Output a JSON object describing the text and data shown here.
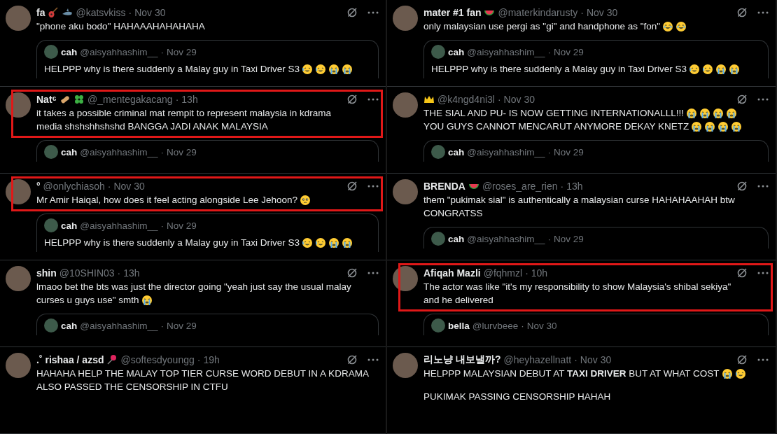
{
  "columns": [
    {
      "tweets": [
        {
          "name": "fa",
          "name_emojis": [
            {
              "kind": "guitar"
            },
            {
              "kind": "shark"
            }
          ],
          "handle": "@katsvkiss",
          "dot": "·",
          "time": "Nov 30",
          "highlighted": false,
          "lines": [
            {
              "text": "\"phone aku bodo\" HAHAAAHAHAHAHA"
            }
          ],
          "quote": {
            "name": "cah",
            "handle": "@aisyahhashim__",
            "dot": "·",
            "time": "Nov 29",
            "text": "HELPPP why is there suddenly a Malay guy in Taxi Driver S3",
            "emojis": [
              {
                "kind": "rofl"
              },
              {
                "kind": "rofl"
              },
              {
                "kind": "sob"
              },
              {
                "kind": "sob"
              }
            ]
          }
        },
        {
          "name": "Nat⁶",
          "name_emojis": [
            {
              "kind": "peanut"
            },
            {
              "kind": "clover"
            }
          ],
          "handle": "@_mentegakacang",
          "dot": "·",
          "time": "13h",
          "highlighted": true,
          "lines": [
            {
              "text": "it takes a possible criminal mat rempit to represent malaysia in kdrama"
            },
            {
              "text": "media shshshhshshd BANGGA JADI ANAK MALAYSIA"
            }
          ],
          "quote": {
            "name": "cah",
            "handle": "@aisyahhashim__",
            "dot": "·",
            "time": "Nov 29"
          }
        },
        {
          "name": "°",
          "handle": "@onlychiasoh",
          "dot": "·",
          "time": "Nov 30",
          "highlighted": true,
          "lines": [
            {
              "text": "Mr Amir Haiqal, how does it feel acting alongside Lee Jehoon?",
              "emojis": [
                {
                  "kind": "pleading"
                }
              ]
            }
          ],
          "quote": {
            "name": "cah",
            "handle": "@aisyahhashim__",
            "dot": "·",
            "time": "Nov 29",
            "text": "HELPPP why is there suddenly a Malay guy in Taxi Driver S3",
            "emojis": [
              {
                "kind": "rofl"
              },
              {
                "kind": "rofl"
              },
              {
                "kind": "sob"
              },
              {
                "kind": "sob"
              }
            ]
          }
        },
        {
          "name": "shin",
          "handle": "@10SHIN03",
          "dot": "·",
          "time": "13h",
          "highlighted": false,
          "lines": [
            {
              "text": "lmaoo bet the bts was just the director going \"yeah just say the usual malay"
            },
            {
              "text": "curses u guys use\" smth",
              "emojis": [
                {
                  "kind": "sob"
                }
              ]
            }
          ],
          "quote": {
            "name": "cah",
            "handle": "@aisyahhashim__",
            "dot": "·",
            "time": "Nov 29"
          }
        },
        {
          "name": ".˚ rishaa / azsd",
          "name_emojis": [
            {
              "kind": "pin"
            }
          ],
          "handle": "@softesdyoungg",
          "dot": "·",
          "time": "19h",
          "highlighted": false,
          "lines": [
            {
              "text": "HAHAHA HELP THE MALAY TOP TIER CURSE WORD DEBUT IN A KDRAMA"
            },
            {
              "text": "ALSO PASSED THE CENSORSHIP IN CTFU"
            }
          ]
        }
      ]
    },
    {
      "tweets": [
        {
          "name": "mater #1 fan",
          "name_emojis": [
            {
              "kind": "watermelon"
            }
          ],
          "handle": "@materkindarusty",
          "dot": "·",
          "time": "Nov 30",
          "highlighted": false,
          "lines": [
            {
              "text": "only malaysian use pergi as \"gi\" and handphone as \"fon\"",
              "emojis": [
                {
                  "kind": "joy"
                },
                {
                  "kind": "joy"
                }
              ]
            }
          ],
          "quote": {
            "name": "cah",
            "handle": "@aisyahhashim__",
            "dot": "·",
            "time": "Nov 29",
            "text": "HELPPP why is there suddenly a Malay guy in Taxi Driver S3",
            "emojis": [
              {
                "kind": "rofl"
              },
              {
                "kind": "rofl"
              },
              {
                "kind": "sob"
              },
              {
                "kind": "sob"
              }
            ]
          }
        },
        {
          "name_emojis": [
            {
              "kind": "crown"
            }
          ],
          "handle": "@k4ngd4ni3l",
          "dot": "·",
          "time": "Nov 30",
          "highlighted": false,
          "lines": [
            {
              "text": "THE SIAL AND PU- IS NOW GETTING INTERNATIONALLL!!!",
              "emojis": [
                {
                  "kind": "sob"
                },
                {
                  "kind": "sob"
                },
                {
                  "kind": "sob"
                },
                {
                  "kind": "sob"
                }
              ]
            },
            {
              "text": "YOU GUYS CANNOT MENCARUT ANYMORE DEKAY KNETZ",
              "emojis": [
                {
                  "kind": "sob"
                },
                {
                  "kind": "sob"
                },
                {
                  "kind": "sob"
                },
                {
                  "kind": "sob"
                }
              ]
            }
          ],
          "quote": {
            "name": "cah",
            "handle": "@aisyahhashim__",
            "dot": "·",
            "time": "Nov 29"
          }
        },
        {
          "name": "BRENDA",
          "name_emojis": [
            {
              "kind": "watermelon"
            }
          ],
          "handle": "@roses_are_rien",
          "dot": "·",
          "time": "13h",
          "highlighted": false,
          "lines": [
            {
              "text": "them \"pukimak sial\" is authentically a malaysian curse HAHAHAAHAH btw"
            },
            {
              "text": "CONGRATSS"
            }
          ],
          "quote": {
            "name": "cah",
            "handle": "@aisyahhashim__",
            "dot": "·",
            "time": "Nov 29"
          }
        },
        {
          "name": "Afiqah Mazli",
          "handle": "@fqhmzl",
          "dot": "·",
          "time": "10h",
          "highlighted": true,
          "lines": [
            {
              "text": "The actor was like \"it's my responsibility to show Malaysia's shibal sekiya\""
            },
            {
              "text": "and he delivered"
            }
          ],
          "quote": {
            "name": "bella",
            "handle": "@lurvbeee",
            "dot": "·",
            "time": "Nov 30"
          }
        },
        {
          "name": "리노냥 내보낼까?",
          "handle": "@heyhazellnatt",
          "dot": "·",
          "time": "Nov 30",
          "highlighted": false,
          "lines": [
            {
              "text": "HELPPP MALAYSIAN DEBUT AT **TAXI DRIVER** BUT AT WHAT COST",
              "emojis": [
                {
                  "kind": "sob"
                },
                {
                  "kind": "rofl"
                }
              ]
            },
            {
              "text": "PUKIMAK PASSING CENSORSHIP HAHAH",
              "spaced": true
            }
          ]
        }
      ]
    }
  ]
}
